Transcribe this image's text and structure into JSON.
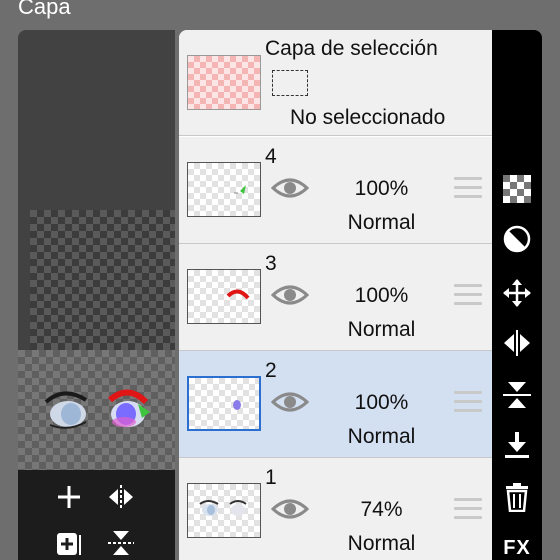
{
  "panel": {
    "title": "Capa"
  },
  "selection_layer": {
    "title": "Capa de selección",
    "status": "No seleccionado"
  },
  "layers": [
    {
      "number": "4",
      "opacity": "100%",
      "blend": "Normal",
      "visible": true,
      "selected": false
    },
    {
      "number": "3",
      "opacity": "100%",
      "blend": "Normal",
      "visible": true,
      "selected": false
    },
    {
      "number": "2",
      "opacity": "100%",
      "blend": "Normal",
      "visible": true,
      "selected": true
    },
    {
      "number": "1",
      "opacity": "74%",
      "blend": "Normal",
      "visible": true,
      "selected": false
    }
  ],
  "right_toolbar": {
    "items": [
      "checker-icon",
      "opacity-icon",
      "move-icon",
      "flip-horizontal-icon",
      "flip-vertical-icon",
      "merge-down-icon",
      "trash-icon"
    ],
    "fx_label": "FX"
  },
  "left_toolbar": {
    "items": [
      "add-layer-icon",
      "flip-horizontal-icon",
      "add-layer-copy-icon",
      "flip-vertical-icon"
    ]
  },
  "colors": {
    "selected_row": "#d3e0f2",
    "selected_border": "#2a6fcf",
    "panel_background": "#6e6e6e",
    "toolbar": "#000000"
  }
}
